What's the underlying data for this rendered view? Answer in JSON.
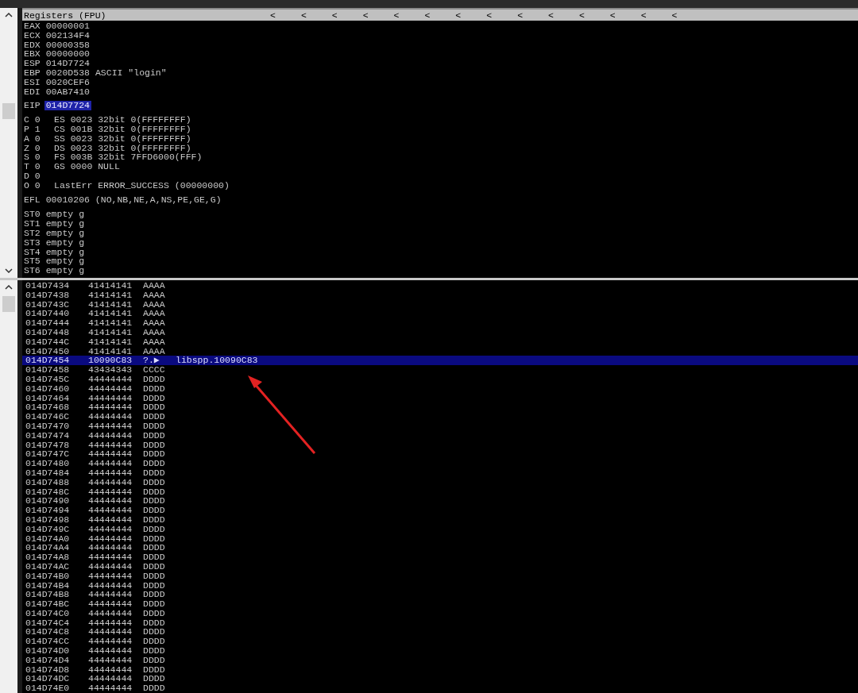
{
  "registers": {
    "title": "Registers (FPU)",
    "markers": [
      "<",
      "<",
      "<",
      "<",
      "<",
      "<",
      "<",
      "<",
      "<",
      "<",
      "<",
      "<",
      "<",
      "<"
    ],
    "general": [
      {
        "name": "EAX",
        "value": "00000001"
      },
      {
        "name": "ECX",
        "value": "002134F4"
      },
      {
        "name": "EDX",
        "value": "00000358"
      },
      {
        "name": "EBX",
        "value": "00000000"
      },
      {
        "name": "ESP",
        "value": "014D7724"
      },
      {
        "name": "EBP",
        "value": "0020D538",
        "comment": "ASCII \"login\""
      },
      {
        "name": "ESI",
        "value": "0020CEF6"
      },
      {
        "name": "EDI",
        "value": "00AB7410"
      }
    ],
    "eip": {
      "name": "EIP",
      "value": "014D7724",
      "selected": true
    },
    "flags": [
      {
        "flag": "C 0",
        "segment": "ES 0023 32bit 0(FFFFFFFF)"
      },
      {
        "flag": "P 1",
        "segment": "CS 001B 32bit 0(FFFFFFFF)"
      },
      {
        "flag": "A 0",
        "segment": "SS 0023 32bit 0(FFFFFFFF)"
      },
      {
        "flag": "Z 0",
        "segment": "DS 0023 32bit 0(FFFFFFFF)"
      },
      {
        "flag": "S 0",
        "segment": "FS 003B 32bit 7FFD6000(FFF)"
      },
      {
        "flag": "T 0",
        "segment": "GS 0000 NULL"
      },
      {
        "flag": "D 0"
      },
      {
        "flag": "O 0",
        "segment": "LastErr ERROR_SUCCESS (00000000)"
      }
    ],
    "efl": {
      "name": "EFL",
      "value": "00010206 (NO,NB,NE,A,NS,PE,GE,G)"
    },
    "fpu": [
      {
        "name": "ST0",
        "value": "empty g"
      },
      {
        "name": "ST1",
        "value": "empty g"
      },
      {
        "name": "ST2",
        "value": "empty g"
      },
      {
        "name": "ST3",
        "value": "empty g"
      },
      {
        "name": "ST4",
        "value": "empty g"
      },
      {
        "name": "ST5",
        "value": "empty g"
      },
      {
        "name": "ST6",
        "value": "empty g"
      }
    ]
  },
  "stack": {
    "rows": [
      {
        "address": "014D7434",
        "value": "41414141",
        "ascii": "AAAA",
        "selected": false
      },
      {
        "address": "014D7438",
        "value": "41414141",
        "ascii": "AAAA",
        "selected": false
      },
      {
        "address": "014D743C",
        "value": "41414141",
        "ascii": "AAAA",
        "selected": false
      },
      {
        "address": "014D7440",
        "value": "41414141",
        "ascii": "AAAA",
        "selected": false
      },
      {
        "address": "014D7444",
        "value": "41414141",
        "ascii": "AAAA",
        "selected": false
      },
      {
        "address": "014D7448",
        "value": "41414141",
        "ascii": "AAAA",
        "selected": false
      },
      {
        "address": "014D744C",
        "value": "41414141",
        "ascii": "AAAA",
        "selected": false
      },
      {
        "address": "014D7450",
        "value": "41414141",
        "ascii": "AAAA",
        "selected": false
      },
      {
        "address": "014D7454",
        "value": "10090C83",
        "ascii": "?.▶",
        "comment": "libspp.10090C83",
        "selected": true
      },
      {
        "address": "014D7458",
        "value": "43434343",
        "ascii": "CCCC",
        "selected": false
      },
      {
        "address": "014D745C",
        "value": "44444444",
        "ascii": "DDDD",
        "selected": false
      },
      {
        "address": "014D7460",
        "value": "44444444",
        "ascii": "DDDD",
        "selected": false
      },
      {
        "address": "014D7464",
        "value": "44444444",
        "ascii": "DDDD",
        "selected": false
      },
      {
        "address": "014D7468",
        "value": "44444444",
        "ascii": "DDDD",
        "selected": false
      },
      {
        "address": "014D746C",
        "value": "44444444",
        "ascii": "DDDD",
        "selected": false
      },
      {
        "address": "014D7470",
        "value": "44444444",
        "ascii": "DDDD",
        "selected": false
      },
      {
        "address": "014D7474",
        "value": "44444444",
        "ascii": "DDDD",
        "selected": false
      },
      {
        "address": "014D7478",
        "value": "44444444",
        "ascii": "DDDD",
        "selected": false
      },
      {
        "address": "014D747C",
        "value": "44444444",
        "ascii": "DDDD",
        "selected": false
      },
      {
        "address": "014D7480",
        "value": "44444444",
        "ascii": "DDDD",
        "selected": false
      },
      {
        "address": "014D7484",
        "value": "44444444",
        "ascii": "DDDD",
        "selected": false
      },
      {
        "address": "014D7488",
        "value": "44444444",
        "ascii": "DDDD",
        "selected": false
      },
      {
        "address": "014D748C",
        "value": "44444444",
        "ascii": "DDDD",
        "selected": false
      },
      {
        "address": "014D7490",
        "value": "44444444",
        "ascii": "DDDD",
        "selected": false
      },
      {
        "address": "014D7494",
        "value": "44444444",
        "ascii": "DDDD",
        "selected": false
      },
      {
        "address": "014D7498",
        "value": "44444444",
        "ascii": "DDDD",
        "selected": false
      },
      {
        "address": "014D749C",
        "value": "44444444",
        "ascii": "DDDD",
        "selected": false
      },
      {
        "address": "014D74A0",
        "value": "44444444",
        "ascii": "DDDD",
        "selected": false
      },
      {
        "address": "014D74A4",
        "value": "44444444",
        "ascii": "DDDD",
        "selected": false
      },
      {
        "address": "014D74A8",
        "value": "44444444",
        "ascii": "DDDD",
        "selected": false
      },
      {
        "address": "014D74AC",
        "value": "44444444",
        "ascii": "DDDD",
        "selected": false
      },
      {
        "address": "014D74B0",
        "value": "44444444",
        "ascii": "DDDD",
        "selected": false
      },
      {
        "address": "014D74B4",
        "value": "44444444",
        "ascii": "DDDD",
        "selected": false
      },
      {
        "address": "014D74B8",
        "value": "44444444",
        "ascii": "DDDD",
        "selected": false
      },
      {
        "address": "014D74BC",
        "value": "44444444",
        "ascii": "DDDD",
        "selected": false
      },
      {
        "address": "014D74C0",
        "value": "44444444",
        "ascii": "DDDD",
        "selected": false
      },
      {
        "address": "014D74C4",
        "value": "44444444",
        "ascii": "DDDD",
        "selected": false
      },
      {
        "address": "014D74C8",
        "value": "44444444",
        "ascii": "DDDD",
        "selected": false
      },
      {
        "address": "014D74CC",
        "value": "44444444",
        "ascii": "DDDD",
        "selected": false
      },
      {
        "address": "014D74D0",
        "value": "44444444",
        "ascii": "DDDD",
        "selected": false
      },
      {
        "address": "014D74D4",
        "value": "44444444",
        "ascii": "DDDD",
        "selected": false
      },
      {
        "address": "014D74D8",
        "value": "44444444",
        "ascii": "DDDD",
        "selected": false
      },
      {
        "address": "014D74DC",
        "value": "44444444",
        "ascii": "DDDD",
        "selected": false
      },
      {
        "address": "014D74E0",
        "value": "44444444",
        "ascii": "DDDD",
        "selected": false
      }
    ]
  }
}
